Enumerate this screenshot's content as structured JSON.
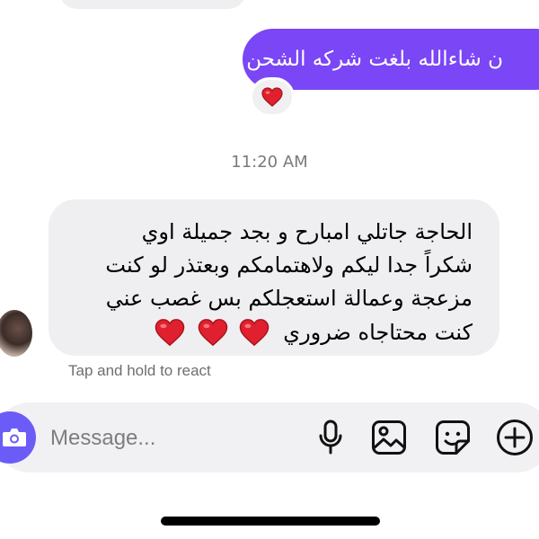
{
  "conversation": {
    "sent_message": {
      "text": "ن شاءالله بلغت شركه الشحن",
      "reaction": "❤️"
    },
    "timestamp": "11:20 AM",
    "received_message": {
      "lines": [
        "الحاجة جاتلي امبارح و بجد جميلة اوي",
        "شكراً جدا ليكم ولاهتمامكم وبعتذر لو كنت",
        "مزعجة وعمالة استعجلكم بس غصب عني"
      ],
      "last_line_text": "كنت محتاجاه ضروري",
      "hearts": [
        "❤️",
        "❤️",
        "❤️"
      ]
    },
    "reaction_hint": "Tap and hold to react"
  },
  "composer": {
    "placeholder": "Message...",
    "icons": [
      "camera-icon",
      "microphone-icon",
      "gallery-icon",
      "sticker-icon",
      "add-icon"
    ]
  },
  "colors": {
    "sent_bubble": "#7b46f6",
    "received_bubble": "#efeff1",
    "camera_button": "#6c5cf7",
    "heart": "#e0202e"
  }
}
